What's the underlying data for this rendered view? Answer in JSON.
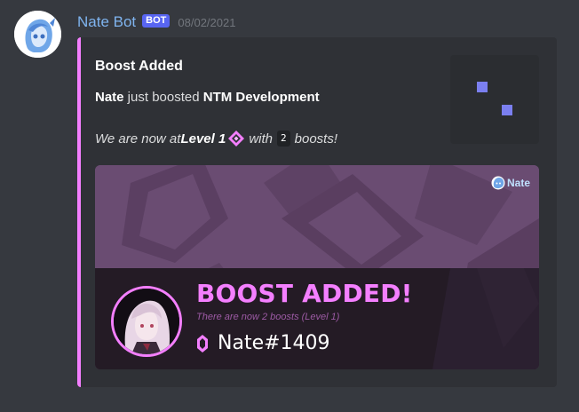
{
  "message": {
    "author": "Nate Bot",
    "bot_tag": "BOT",
    "timestamp": "08/02/2021"
  },
  "embed": {
    "accent_color": "#f47fff",
    "title": "Boost Added",
    "line1": {
      "user": "Nate",
      "middle": " just boosted ",
      "server": "NTM Development"
    },
    "line2": {
      "prefix": "We are now at ",
      "level": "Level 1",
      "with": " with ",
      "count": "2",
      "suffix": " boosts!"
    },
    "thumbnail_icon": "squares-icon"
  },
  "banner": {
    "brand": "Nate",
    "heading": "BOOST ADDED!",
    "subtitle": "There are now 2 boosts (Level 1)",
    "username": "Nate#1409",
    "colors": {
      "pink": "#f47fff",
      "bg_top": "#6a4c72",
      "bg_bottom": "#241b25"
    }
  }
}
